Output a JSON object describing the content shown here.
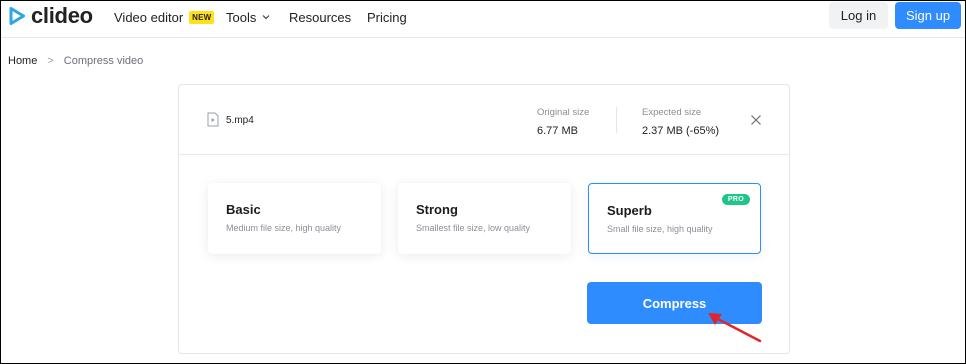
{
  "header": {
    "logo": "clideo",
    "nav": [
      {
        "label": "Video editor",
        "badge": "NEW"
      },
      {
        "label": "Tools"
      },
      {
        "label": "Resources"
      },
      {
        "label": "Pricing"
      }
    ],
    "login_label": "Log in",
    "signup_label": "Sign up"
  },
  "breadcrumb": {
    "home": "Home",
    "separator": ">",
    "current": "Compress video"
  },
  "file": {
    "name": "5.mp4",
    "original_size_label": "Original size",
    "original_size_value": "6.77 MB",
    "expected_size_label": "Expected size",
    "expected_size_value": "2.37 MB (-65%)"
  },
  "options": [
    {
      "title": "Basic",
      "subtitle": "Medium file size, high quality"
    },
    {
      "title": "Strong",
      "subtitle": "Smallest file size, low quality"
    },
    {
      "title": "Superb",
      "subtitle": "Small file size, high quality",
      "badge": "PRO",
      "selected": true
    }
  ],
  "compress_label": "Compress",
  "colors": {
    "accent": "#2f8cff",
    "pro_badge": "#1fc58a",
    "new_badge": "#ffe01a",
    "arrow": "#e0262b"
  },
  "icons": [
    "play-logo-icon",
    "chevron-down-icon",
    "file-icon",
    "close-icon",
    "arrow-annotation-icon"
  ]
}
